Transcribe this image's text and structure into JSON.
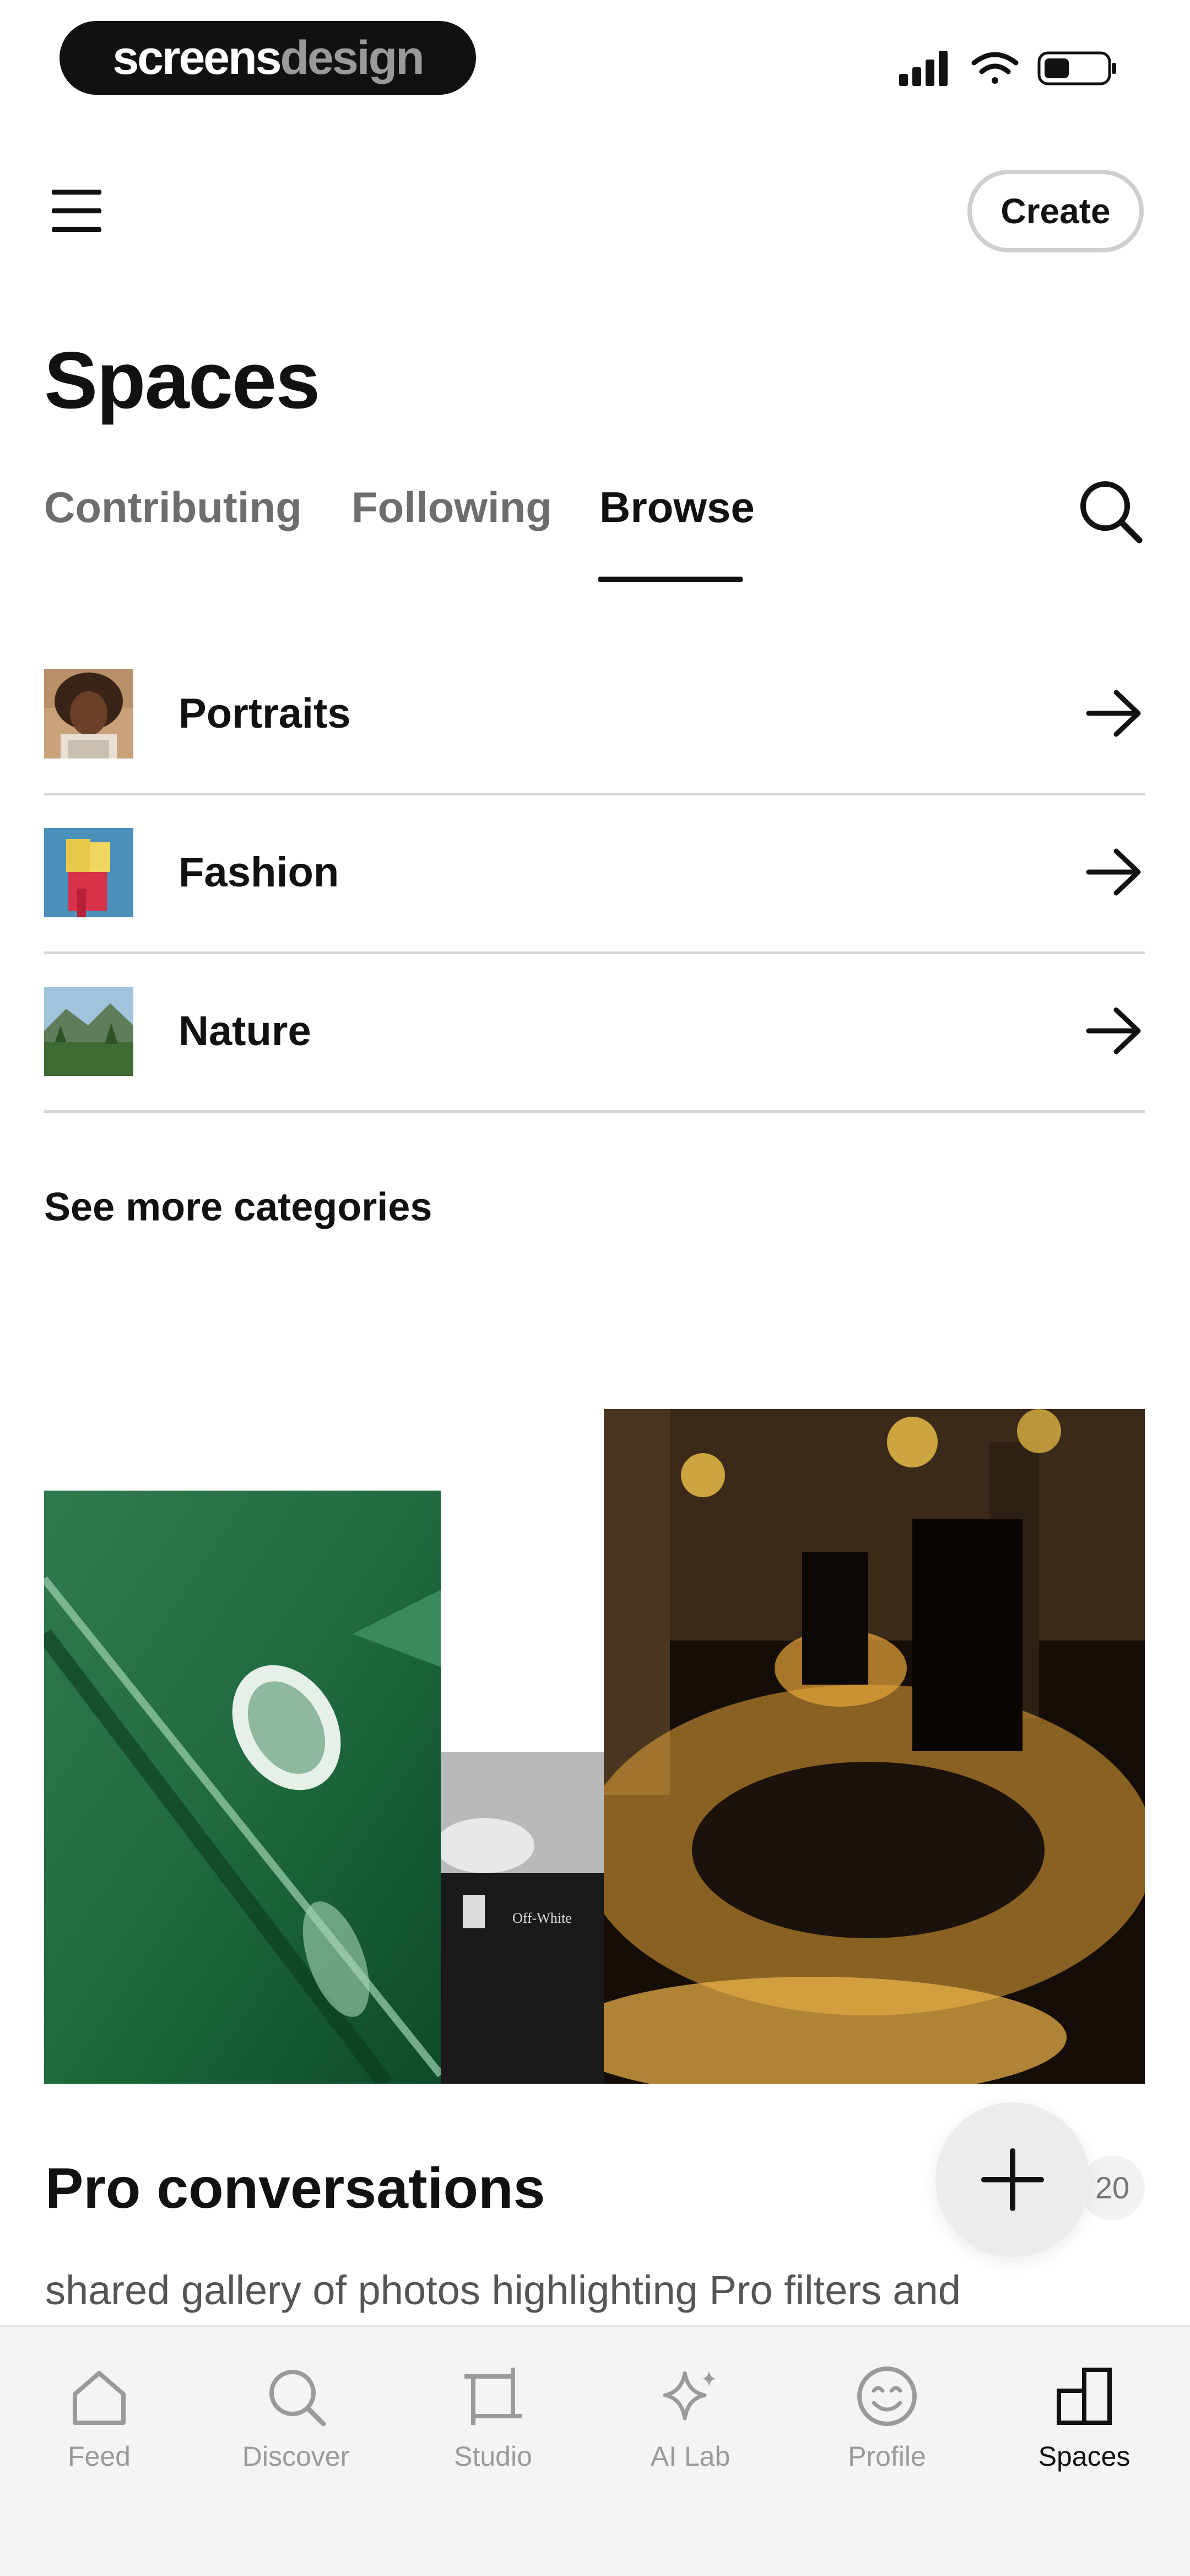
{
  "status_bar": {
    "brand_part1": "screens",
    "brand_part2": "design"
  },
  "header": {
    "create_label": "Create"
  },
  "page": {
    "title": "Spaces"
  },
  "tabs": [
    {
      "label": "Contributing",
      "active": false
    },
    {
      "label": "Following",
      "active": false
    },
    {
      "label": "Browse",
      "active": true
    }
  ],
  "categories": [
    {
      "label": "Portraits"
    },
    {
      "label": "Fashion"
    },
    {
      "label": "Nature"
    }
  ],
  "see_more_label": "See more categories",
  "card": {
    "title": "Pro conversations",
    "description": "shared gallery of photos highlighting Pro filters and",
    "count": "20"
  },
  "bottom_nav": [
    {
      "label": "Feed",
      "icon": "home-icon"
    },
    {
      "label": "Discover",
      "icon": "search-icon"
    },
    {
      "label": "Studio",
      "icon": "crop-icon"
    },
    {
      "label": "AI Lab",
      "icon": "sparkle-icon"
    },
    {
      "label": "Profile",
      "icon": "smiley-icon"
    },
    {
      "label": "Spaces",
      "icon": "spaces-icon",
      "active": true
    }
  ],
  "colors": {
    "accent": "#111111",
    "inactive": "#6d6d6d",
    "divider": "#d6d6d6"
  }
}
